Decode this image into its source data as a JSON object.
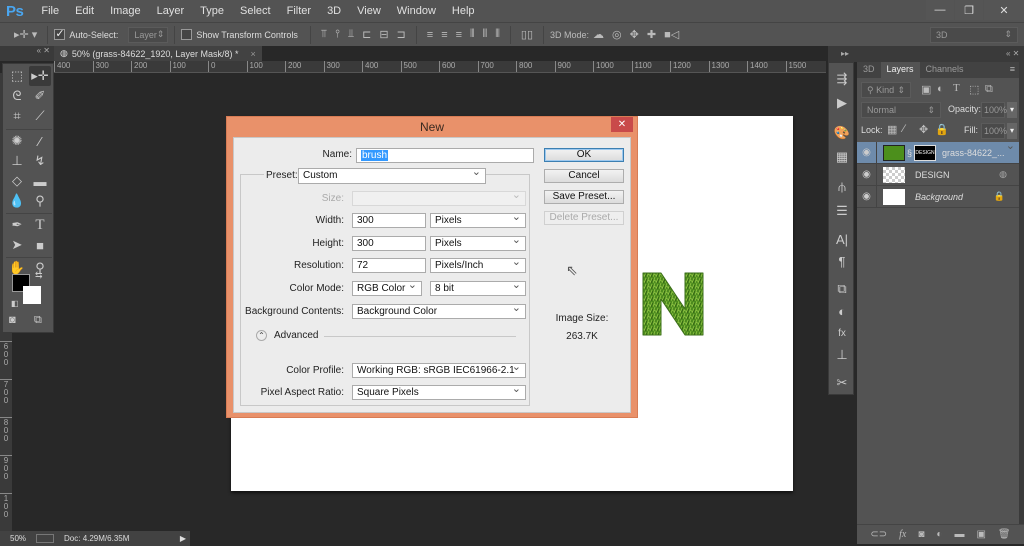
{
  "app": {
    "logo": "Ps"
  },
  "menubar": {
    "items": [
      "File",
      "Edit",
      "Image",
      "Layer",
      "Type",
      "Select",
      "Filter",
      "3D",
      "View",
      "Window",
      "Help"
    ],
    "window_controls": {
      "minimize": "—",
      "restore": "❐",
      "close": "✕"
    }
  },
  "options_bar": {
    "auto_select_label": "Auto-Select:",
    "auto_select_checked": true,
    "auto_select_target": "Layer",
    "show_transform_label": "Show Transform Controls",
    "show_transform_checked": false,
    "mode_label": "3D Mode:",
    "workspace": "3D"
  },
  "document_tab": {
    "title": "50% (grass-84622_1920, Layer Mask/8) *",
    "close": "×"
  },
  "rulers": {
    "horizontal": [
      "400",
      "300",
      "200",
      "100",
      "0",
      "100",
      "200",
      "300",
      "400",
      "500",
      "600",
      "700",
      "800",
      "900",
      "1000",
      "1100",
      "1200",
      "1300",
      "1400",
      "1500"
    ],
    "vertical": [
      "6",
      "7",
      "8",
      "9",
      "1"
    ]
  },
  "toolbox": {
    "tools": [
      "rectangular-marquee",
      "move",
      "lasso",
      "quick-selection",
      "crop",
      "eyedropper",
      "spot-healing",
      "brush",
      "clone-stamp",
      "history-brush",
      "eraser",
      "gradient",
      "blur",
      "dodge",
      "pen",
      "type",
      "path-selection",
      "rectangle",
      "hand",
      "zoom"
    ]
  },
  "dialog": {
    "title": "New",
    "close": "✕",
    "name_label": "Name:",
    "name_value": "brush",
    "preset_label": "Preset:",
    "preset_value": "Custom",
    "size_label": "Size:",
    "size_value": "",
    "width_label": "Width:",
    "width_value": "300",
    "width_unit": "Pixels",
    "height_label": "Height:",
    "height_value": "300",
    "height_unit": "Pixels",
    "resolution_label": "Resolution:",
    "resolution_value": "72",
    "resolution_unit": "Pixels/Inch",
    "color_mode_label": "Color Mode:",
    "color_mode_value": "RGB Color",
    "bit_depth": "8 bit",
    "bg_contents_label": "Background Contents:",
    "bg_contents_value": "Background Color",
    "advanced_label": "Advanced",
    "color_profile_label": "Color Profile:",
    "color_profile_value": "Working RGB:  sRGB IEC61966-2.1",
    "pixel_aspect_label": "Pixel Aspect Ratio:",
    "pixel_aspect_value": "Square Pixels",
    "buttons": {
      "ok": "OK",
      "cancel": "Cancel",
      "save_preset": "Save Preset...",
      "delete_preset": "Delete Preset..."
    },
    "image_size_label": "Image Size:",
    "image_size_value": "263.7K"
  },
  "canvas": {
    "visible_letter": "N"
  },
  "layers_panel": {
    "tabs": [
      "3D",
      "Layers",
      "Channels"
    ],
    "active_tab": "Layers",
    "filter_kind": "Kind",
    "blend_mode": "Normal",
    "opacity_label": "Opacity:",
    "opacity_value": "100%",
    "lock_label": "Lock:",
    "fill_label": "Fill:",
    "fill_value": "100%",
    "layers": [
      {
        "name": "grass-84622_...",
        "mask_text": "DESIGN",
        "selected": true
      },
      {
        "name": "DESIGN",
        "selected": false
      },
      {
        "name": "Background",
        "selected": false,
        "locked": true
      }
    ],
    "footer_icons": [
      "link",
      "fx",
      "mask",
      "adjustment",
      "group",
      "new-layer",
      "delete"
    ]
  },
  "status_bar": {
    "zoom": "50%",
    "doc_info": "Doc: 4.29M/6.35M",
    "arrow": "▶"
  },
  "colors": {
    "dialog_frame": "#e9916a",
    "close_red": "#c94a4a",
    "selection_blue": "#3399ff",
    "selected_layer": "#6e8bab"
  }
}
